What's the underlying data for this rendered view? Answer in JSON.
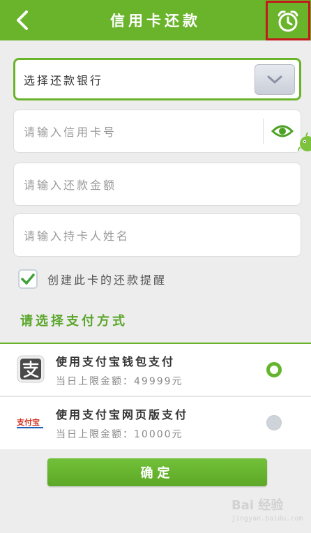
{
  "header": {
    "title": "信用卡还款",
    "back_icon": "chevron-left-icon",
    "alarm_icon": "alarm-clock-icon",
    "accent": "#6ab42c",
    "highlight_border": "#c01a1a"
  },
  "form": {
    "bank_select_label": "选择还款银行",
    "card_number_placeholder": "请输入信用卡号",
    "amount_placeholder": "请输入还款金额",
    "holder_name_placeholder": "请输入持卡人姓名",
    "eye_icon": "eye-icon"
  },
  "reminder": {
    "label": "创建此卡的还款提醒",
    "checked": true
  },
  "payment": {
    "section_title": "请选择支付方式",
    "options": [
      {
        "name": "使用支付宝钱包支付",
        "limit": "当日上限金额：49999元",
        "selected": true,
        "icon": "alipay-wallet-icon"
      },
      {
        "name": "使用支付宝网页版支付",
        "limit": "当日上限金额：10000元",
        "selected": false,
        "icon": "alipay-logo-icon"
      }
    ]
  },
  "confirm_label": "确定",
  "watermark": {
    "brand": "Bai 经验",
    "url": "jingyan.baidu.com"
  }
}
